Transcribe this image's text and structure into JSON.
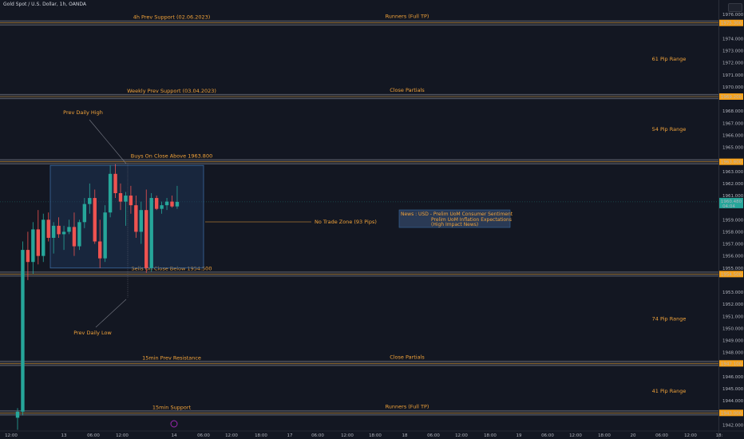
{
  "header": {
    "symbol_title": "Gold Spot / U.S. Dollar, 1h, OANDA"
  },
  "colors": {
    "background": "#131722",
    "bull": "#26a69a",
    "bear": "#ef5350",
    "annotation": "#f2a33a",
    "zone_fill": "#1e3a5f",
    "zone_border": "#3b6aa0",
    "level_tag": "#f7a21b"
  },
  "price_axis": {
    "min": 1941.5,
    "max": 1977.0,
    "tick_labels": [
      "1976.000",
      "1974.000",
      "1973.000",
      "1972.000",
      "1971.000",
      "1970.000",
      "1968.000",
      "1967.000",
      "1966.000",
      "1965.000",
      "1963.000",
      "1962.000",
      "1961.000",
      "1959.000",
      "1958.000",
      "1957.000",
      "1956.000",
      "1955.000",
      "1953.000",
      "1952.000",
      "1951.000",
      "1950.000",
      "1949.000",
      "1948.000",
      "1946.000",
      "1945.000",
      "1944.000",
      "1942.000"
    ],
    "tick_values": [
      1976,
      1974,
      1973,
      1972,
      1971,
      1970,
      1968,
      1967,
      1966,
      1965,
      1963,
      1962,
      1961,
      1959,
      1958,
      1957,
      1956,
      1955,
      1953,
      1952,
      1951,
      1950,
      1949,
      1948,
      1946,
      1945,
      1944,
      1942
    ],
    "level_tags": [
      {
        "label": "1975.300",
        "value": 1975.3
      },
      {
        "label": "1969.200",
        "value": 1969.2
      },
      {
        "label": "1963.800",
        "value": 1963.8
      },
      {
        "label": "1954.500",
        "value": 1954.5
      },
      {
        "label": "1947.100",
        "value": 1947.1
      },
      {
        "label": "1943.000",
        "value": 1943.0
      }
    ],
    "current_price": {
      "label": "1960.480",
      "countdown": "04:04",
      "value": 1960.48
    }
  },
  "time_axis": {
    "labels": [
      "12:00",
      "13",
      "06:00",
      "12:00",
      "14",
      "06:00",
      "12:00",
      "18:00",
      "17",
      "06:00",
      "12:00",
      "18:00",
      "18",
      "06:00",
      "12:00",
      "18:00",
      "19",
      "06:00",
      "12:00",
      "18:00",
      "20",
      "06:00",
      "12:00",
      "18:"
    ]
  },
  "levels": [
    {
      "value": 1975.3,
      "left_text": "4h Prev Support (02.06.2023)",
      "right_text": "Runners (Full TP)"
    },
    {
      "value": 1969.2,
      "left_text": "Weekly Prev Support (03.04.2023)",
      "right_text": "Close Partials"
    },
    {
      "value": 1963.8,
      "left_text": "Buys On Close Above 1963.800",
      "right_text": ""
    },
    {
      "value": 1954.5,
      "left_text": "Sells On Close Below 1954.500",
      "right_text": ""
    },
    {
      "value": 1947.1,
      "left_text": "15min Prev Resistance",
      "right_text": "Close Partials"
    },
    {
      "value": 1943.0,
      "left_text": "15min Support",
      "right_text": "Runners (Full TP)"
    }
  ],
  "range_labels": [
    {
      "text": "61 Pip Range",
      "value": 1972.3
    },
    {
      "text": "54 Pip Range",
      "value": 1966.5
    },
    {
      "text": "74 Pip Range",
      "value": 1950.8
    },
    {
      "text": "41 Pip Range",
      "value": 1944.8
    }
  ],
  "annotations": {
    "prev_daily_high": "Prev Daily High",
    "prev_daily_low": "Prev Daily Low",
    "no_trade_zone": "No Trade Zone (93 Pips)",
    "news_lines": [
      "News : USD - Prelim UoM Consumer Sentiment",
      "Prelim UoM Inflation Expectations",
      "(High Impact News)"
    ]
  },
  "chart_data": {
    "type": "candlestick",
    "candles": [
      {
        "o": 1942.6,
        "h": 1943.4,
        "l": 1941.6,
        "c": 1943.1
      },
      {
        "o": 1943.1,
        "h": 1957.2,
        "l": 1942.8,
        "c": 1956.5
      },
      {
        "o": 1956.5,
        "h": 1958.0,
        "l": 1954.0,
        "c": 1955.5
      },
      {
        "o": 1955.5,
        "h": 1958.8,
        "l": 1954.5,
        "c": 1958.2
      },
      {
        "o": 1958.2,
        "h": 1959.8,
        "l": 1955.3,
        "c": 1956.0
      },
      {
        "o": 1956.0,
        "h": 1959.5,
        "l": 1955.5,
        "c": 1959.0
      },
      {
        "o": 1959.0,
        "h": 1959.6,
        "l": 1957.2,
        "c": 1957.5
      },
      {
        "o": 1957.5,
        "h": 1958.8,
        "l": 1956.2,
        "c": 1958.5
      },
      {
        "o": 1958.5,
        "h": 1959.2,
        "l": 1957.5,
        "c": 1957.8
      },
      {
        "o": 1957.8,
        "h": 1958.5,
        "l": 1956.5,
        "c": 1958.0
      },
      {
        "o": 1958.0,
        "h": 1959.0,
        "l": 1957.8,
        "c": 1958.4
      },
      {
        "o": 1958.4,
        "h": 1959.6,
        "l": 1956.0,
        "c": 1956.8
      },
      {
        "o": 1956.8,
        "h": 1959.0,
        "l": 1956.5,
        "c": 1958.8
      },
      {
        "o": 1958.8,
        "h": 1960.8,
        "l": 1958.3,
        "c": 1960.3
      },
      {
        "o": 1960.3,
        "h": 1962.0,
        "l": 1959.5,
        "c": 1960.8
      },
      {
        "o": 1960.8,
        "h": 1961.5,
        "l": 1957.0,
        "c": 1957.2
      },
      {
        "o": 1957.2,
        "h": 1959.0,
        "l": 1955.0,
        "c": 1955.8
      },
      {
        "o": 1955.8,
        "h": 1960.2,
        "l": 1955.5,
        "c": 1959.6
      },
      {
        "o": 1959.6,
        "h": 1963.5,
        "l": 1959.2,
        "c": 1962.8
      },
      {
        "o": 1962.8,
        "h": 1963.6,
        "l": 1960.8,
        "c": 1961.2
      },
      {
        "o": 1961.2,
        "h": 1962.0,
        "l": 1959.8,
        "c": 1960.5
      },
      {
        "o": 1960.5,
        "h": 1961.3,
        "l": 1958.5,
        "c": 1961.0
      },
      {
        "o": 1961.0,
        "h": 1961.8,
        "l": 1959.5,
        "c": 1960.2
      },
      {
        "o": 1960.2,
        "h": 1961.0,
        "l": 1957.5,
        "c": 1958.0
      },
      {
        "o": 1958.0,
        "h": 1960.5,
        "l": 1957.0,
        "c": 1959.8
      },
      {
        "o": 1959.8,
        "h": 1961.5,
        "l": 1954.6,
        "c": 1955.0
      },
      {
        "o": 1955.0,
        "h": 1961.2,
        "l": 1954.7,
        "c": 1960.8
      },
      {
        "o": 1960.8,
        "h": 1961.0,
        "l": 1959.8,
        "c": 1959.9
      },
      {
        "o": 1959.9,
        "h": 1960.5,
        "l": 1959.5,
        "c": 1960.2
      },
      {
        "o": 1960.2,
        "h": 1960.8,
        "l": 1959.8,
        "c": 1960.5
      },
      {
        "o": 1960.5,
        "h": 1961.0,
        "l": 1960.0,
        "c": 1960.1
      },
      {
        "o": 1960.1,
        "h": 1961.8,
        "l": 1959.9,
        "c": 1960.48
      }
    ]
  }
}
